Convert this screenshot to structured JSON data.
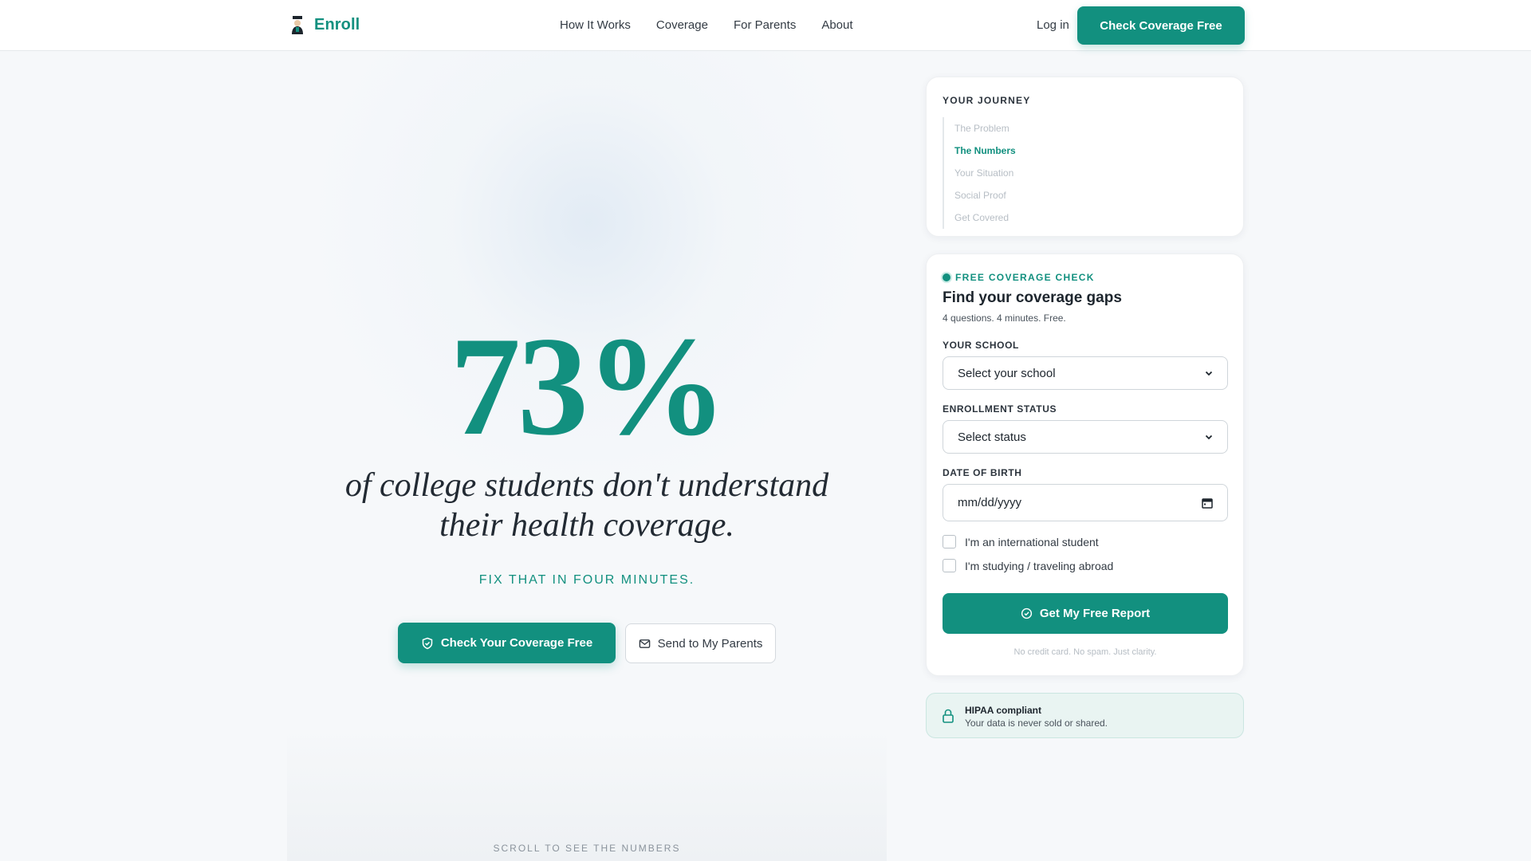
{
  "brand": {
    "name": "Enroll",
    "icon": "college-graduate-icon",
    "accent": "#12907f"
  },
  "nav": {
    "links": [
      "How It Works",
      "Coverage",
      "For Parents",
      "About"
    ],
    "login": "Log in",
    "cta": "Check Coverage Free"
  },
  "hero": {
    "stat": "73%",
    "subtitle_line1": "of college students don't understand",
    "subtitle_line2": "their health coverage.",
    "tagline": "FIX THAT IN FOUR MINUTES.",
    "primary_cta": "Check Your Coverage Free",
    "primary_cta_icon": "shield-check-icon",
    "secondary_cta": "Send to My Parents",
    "secondary_cta_icon": "mail-icon",
    "scroll_hint": "SCROLL TO SEE THE NUMBERS"
  },
  "journey": {
    "title": "YOUR JOURNEY",
    "steps": [
      "The Problem",
      "The Numbers",
      "Your Situation",
      "Social Proof",
      "Get Covered"
    ],
    "active_step": "The Numbers"
  },
  "form": {
    "badge": "FREE COVERAGE CHECK",
    "title": "Find your coverage gaps",
    "subtitle": "4 questions. 4 minutes. Free.",
    "school_label": "YOUR SCHOOL",
    "school_value": "Select your school",
    "status_label": "ENROLLMENT STATUS",
    "status_value": "Select status",
    "dob_label": "DATE OF BIRTH",
    "dob_value": "mm/dd/yyyy",
    "checkbox_international": "I'm an international student",
    "checkbox_abroad": "I'm studying / traveling abroad",
    "submit": "Get My Free Report",
    "submit_icon": "check-circle-icon",
    "note": "No credit card. No spam. Just clarity."
  },
  "hipaa": {
    "title": "HIPAA compliant",
    "subtitle": "Your data is never sold or shared.",
    "icon": "lock-icon"
  }
}
